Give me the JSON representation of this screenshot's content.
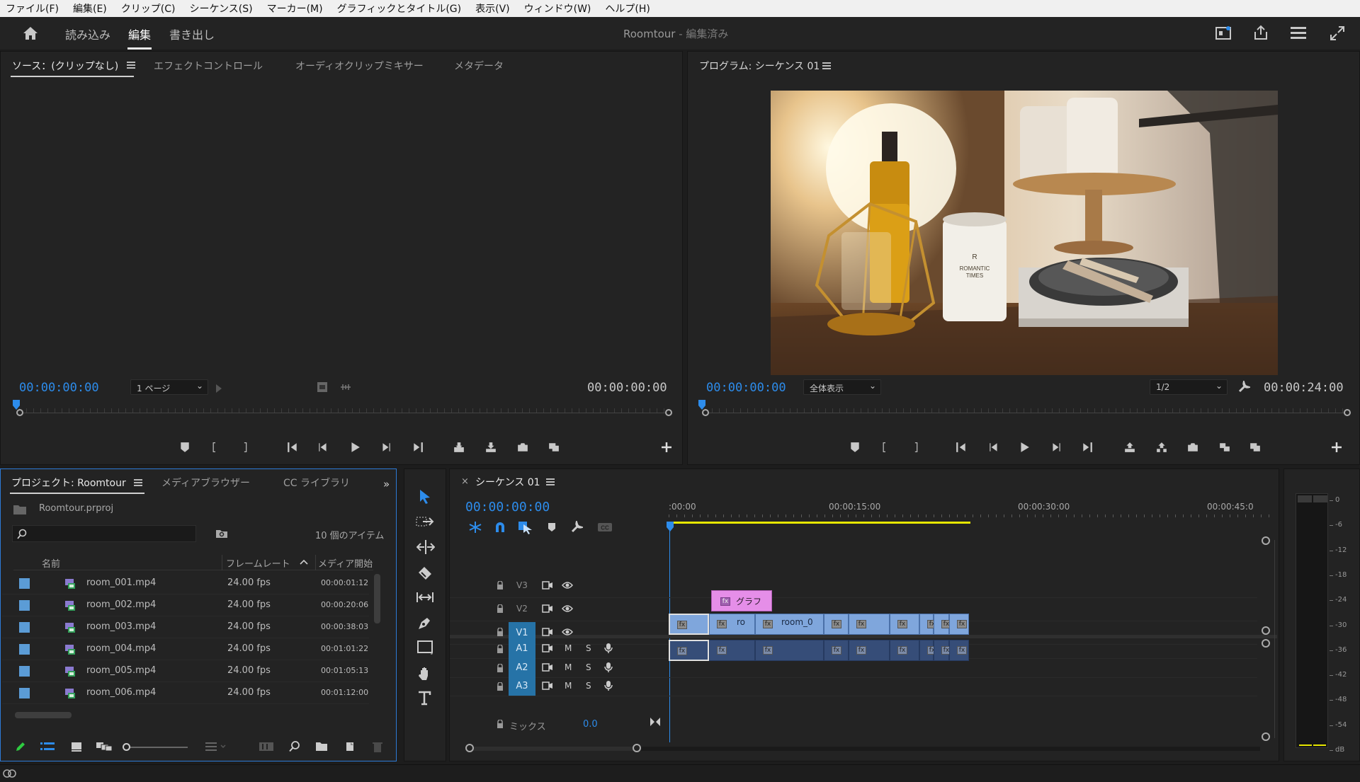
{
  "menu": [
    "ファイル(F)",
    "編集(E)",
    "クリップ(C)",
    "シーケンス(S)",
    "マーカー(M)",
    "グラフィックとタイトル(G)",
    "表示(V)",
    "ウィンドウ(W)",
    "ヘルプ(H)"
  ],
  "header": {
    "workspaces": [
      "読み込み",
      "編集",
      "書き出し"
    ],
    "project_name": "Roomtour",
    "status": " - 編集済み"
  },
  "source_panel": {
    "tabs": [
      "ソース：(クリップなし)",
      "エフェクトコントロール",
      "オーディオクリップミキサー",
      "メタデータ"
    ],
    "timecode_in": "00:00:00:00",
    "timecode_out": "00:00:00:00",
    "page_select": "1 ページ"
  },
  "program_panel": {
    "title": "プログラム: シーケンス 01",
    "timecode_in": "00:00:00:00",
    "timecode_out": "00:00:24:00",
    "fit_select": "全体表示",
    "resolution_select": "1/2",
    "image_text": [
      "R",
      "ROMANTIC",
      "TIMES"
    ]
  },
  "project_panel": {
    "tabs": [
      "プロジェクト: Roomtour",
      "メディアブラウザー",
      "CC ライブラリ"
    ],
    "file": "Roomtour.prproj",
    "item_count": "10 個のアイテム",
    "columns": [
      "名前",
      "フレームレート",
      "メディア開始"
    ],
    "rows": [
      {
        "name": "room_001.mp4",
        "fps": "24.00 fps",
        "start": "00:00:01:12"
      },
      {
        "name": "room_002.mp4",
        "fps": "24.00 fps",
        "start": "00:00:20:06"
      },
      {
        "name": "room_003.mp4",
        "fps": "24.00 fps",
        "start": "00:00:38:03"
      },
      {
        "name": "room_004.mp4",
        "fps": "24.00 fps",
        "start": "00:01:01:22"
      },
      {
        "name": "room_005.mp4",
        "fps": "24.00 fps",
        "start": "00:01:05:13"
      },
      {
        "name": "room_006.mp4",
        "fps": "24.00 fps",
        "start": "00:01:12:00"
      }
    ]
  },
  "timeline": {
    "close": "×",
    "title": "シーケンス 01",
    "timecode": "00:00:00:00",
    "ruler": [
      ":00:00",
      "00:00:15:00",
      "00:00:30:00",
      "00:00:45:0"
    ],
    "tracks_video": [
      "V3",
      "V2",
      "V1"
    ],
    "tracks_audio": [
      "A1",
      "A2",
      "A3"
    ],
    "mute": "M",
    "solo": "S",
    "mix_label": "ミックス",
    "mix_value": "0.0",
    "graphic_clip": "グラフ",
    "clip_label_1": "ro",
    "clip_label_2": "room_0",
    "fx": "fx"
  },
  "meter": {
    "scale": [
      "0",
      "-6",
      "-12",
      "-18",
      "-24",
      "-30",
      "-36",
      "-42",
      "-48",
      "-54",
      "dB"
    ]
  },
  "colors": {
    "accent_blue": "#2d8ceb",
    "panel_bg": "#232323",
    "video_clip": "#7fa6dc",
    "audio_clip": "#364d78",
    "graphic_clip": "#e58ee8",
    "work_area": "#e6e600",
    "track_target": "#2673a7"
  }
}
